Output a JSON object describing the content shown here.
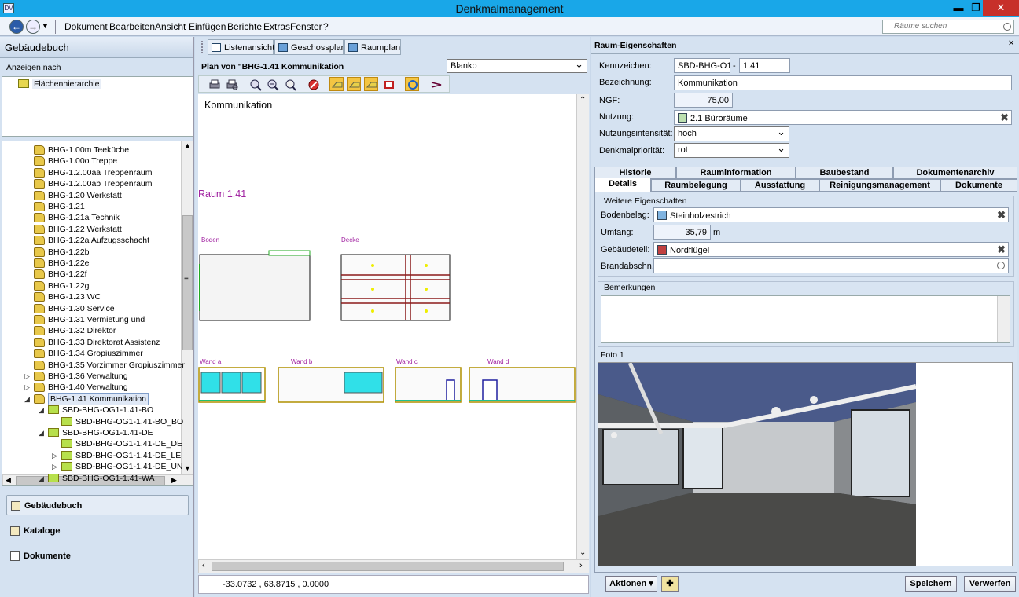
{
  "window": {
    "title": "Denkmalmanagement",
    "app_icon": "app-icon",
    "minimize": "▬",
    "maximize": "❐",
    "close": "✕"
  },
  "menu": {
    "back_icon": "back-arrow-icon",
    "forward_icon": "forward-arrow-icon",
    "items": [
      "Dokument",
      "Bearbeiten",
      "Ansicht",
      "Einfügen",
      "Berichte",
      "Extras",
      "Fenster",
      "?"
    ],
    "search_placeholder": "Räume suchen"
  },
  "left": {
    "header": "Gebäudebuch",
    "display_by_label": "Anzeigen nach",
    "hierarchy_item": "Flächenhierarchie",
    "tree": [
      {
        "label": "BHG-1.00m Teeküche",
        "level": 0
      },
      {
        "label": "BHG-1.00o Treppe",
        "level": 0
      },
      {
        "label": "BHG-1.2.00aa Treppenraum",
        "level": 0
      },
      {
        "label": "BHG-1.2.00ab Treppenraum",
        "level": 0
      },
      {
        "label": "BHG-1.20 Werkstatt",
        "level": 0
      },
      {
        "label": "BHG-1.21",
        "level": 0
      },
      {
        "label": "BHG-1.21a Technik",
        "level": 0
      },
      {
        "label": "BHG-1.22 Werkstatt",
        "level": 0
      },
      {
        "label": "BHG-1.22a Aufzugsschacht",
        "level": 0
      },
      {
        "label": "BHG-1.22b",
        "level": 0
      },
      {
        "label": "BHG-1.22e",
        "level": 0
      },
      {
        "label": "BHG-1.22f",
        "level": 0
      },
      {
        "label": "BHG-1.22g",
        "level": 0
      },
      {
        "label": "BHG-1.23 WC",
        "level": 0
      },
      {
        "label": "BHG-1.30 Service",
        "level": 0
      },
      {
        "label": "BHG-1.31 Vermietung und",
        "level": 0
      },
      {
        "label": "BHG-1.32 Direktor",
        "level": 0
      },
      {
        "label": "BHG-1.33 Direktorat Assistenz",
        "level": 0
      },
      {
        "label": "BHG-1.34 Gropiuszimmer",
        "level": 0
      },
      {
        "label": "BHG-1.35 Vorzimmer Gropiuszimmer",
        "level": 0
      },
      {
        "label": "BHG-1.36 Verwaltung",
        "level": 0,
        "expander": "▷"
      },
      {
        "label": "BHG-1.40 Verwaltung",
        "level": 0,
        "expander": "▷"
      },
      {
        "label": "BHG-1.41 Kommunikation",
        "level": 0,
        "expander": "◢",
        "selected": true
      },
      {
        "label": "SBD-BHG-OG1-1.41-BO",
        "level": 1,
        "expander": "◢"
      },
      {
        "label": "SBD-BHG-OG1-1.41-BO_BO",
        "level": 2
      },
      {
        "label": "SBD-BHG-OG1-1.41-DE",
        "level": 1,
        "expander": "◢"
      },
      {
        "label": "SBD-BHG-OG1-1.41-DE_DE",
        "level": 2
      },
      {
        "label": "SBD-BHG-OG1-1.41-DE_LE",
        "level": 2,
        "expander": "▷"
      },
      {
        "label": "SBD-BHG-OG1-1.41-DE_UN",
        "level": 2,
        "expander": "▷"
      },
      {
        "label": "SBD-BHG-OG1-1.41-WA",
        "level": 1,
        "expander": "◢"
      }
    ],
    "nav": [
      "Gebäudebuch",
      "Kataloge",
      "Dokumente"
    ]
  },
  "center": {
    "view_buttons": [
      "Listenansicht",
      "Geschossplan",
      "Raumplan"
    ],
    "plan_label": "Plan von \"BHG-1.41 Kommunikation",
    "plan_select": "Blanko",
    "canvas_title": "Kommunikation",
    "room_label": "Raum 1.41",
    "floor_label": "Boden",
    "ceiling_label": "Decke",
    "wall_labels": [
      "Wand a",
      "Wand b",
      "Wand c",
      "Wand d"
    ],
    "coords": "-33.0732 , 63.8715 , 0.0000",
    "tool_icons": [
      "print-icon",
      "print-preview-icon",
      "zoom-in-icon",
      "zoom-out-icon",
      "zoom-fit-icon",
      "stop-icon",
      "layer-1-icon",
      "layer-2-icon",
      "layer-3-icon",
      "layer-red-icon",
      "refresh-icon",
      "measure-icon"
    ]
  },
  "right": {
    "header": "Raum-Eigenschaften",
    "fields": {
      "kennzeichen_label": "Kennzeichen:",
      "kennzeichen_value": "SBD-BHG-O1",
      "kennzeichen_dash": "-",
      "kennzeichen_value2": "1.41",
      "bezeichnung_label": "Bezeichnung:",
      "bezeichnung_value": "Kommunikation",
      "ngf_label": "NGF:",
      "ngf_value": "75,00",
      "nutzung_label": "Nutzung:",
      "nutzung_value": "2.1 Büroräume",
      "intensitaet_label": "Nutzungsintensität:",
      "intensitaet_value": "hoch",
      "prioritaet_label": "Denkmalpriorität:",
      "prioritaet_value": "rot"
    },
    "tabs_row1": [
      "Historie",
      "Rauminformation",
      "Baubestand",
      "Dokumentenarchiv"
    ],
    "tabs_row2": [
      "Details",
      "Raumbelegung",
      "Ausstattung",
      "Reinigungsmanagement",
      "Dokumente"
    ],
    "details": {
      "group_title": "Weitere Eigenschaften",
      "bodenbelag_label": "Bodenbelag:",
      "bodenbelag_value": "Steinholzestrich",
      "umfang_label": "Umfang:",
      "umfang_value": "35,79",
      "umfang_unit": "m",
      "gebaeudeteil_label": "Gebäudeteil:",
      "gebaeudeteil_value": "Nordflügel",
      "brandabschn_label": "Brandabschn.:",
      "brandabschn_value": "",
      "bemerkungen_label": "Bemerkungen",
      "foto_label": "Foto 1"
    },
    "buttons": {
      "aktionen": "Aktionen",
      "speichern": "Speichern",
      "verwerfen": "Verwerfen"
    }
  }
}
